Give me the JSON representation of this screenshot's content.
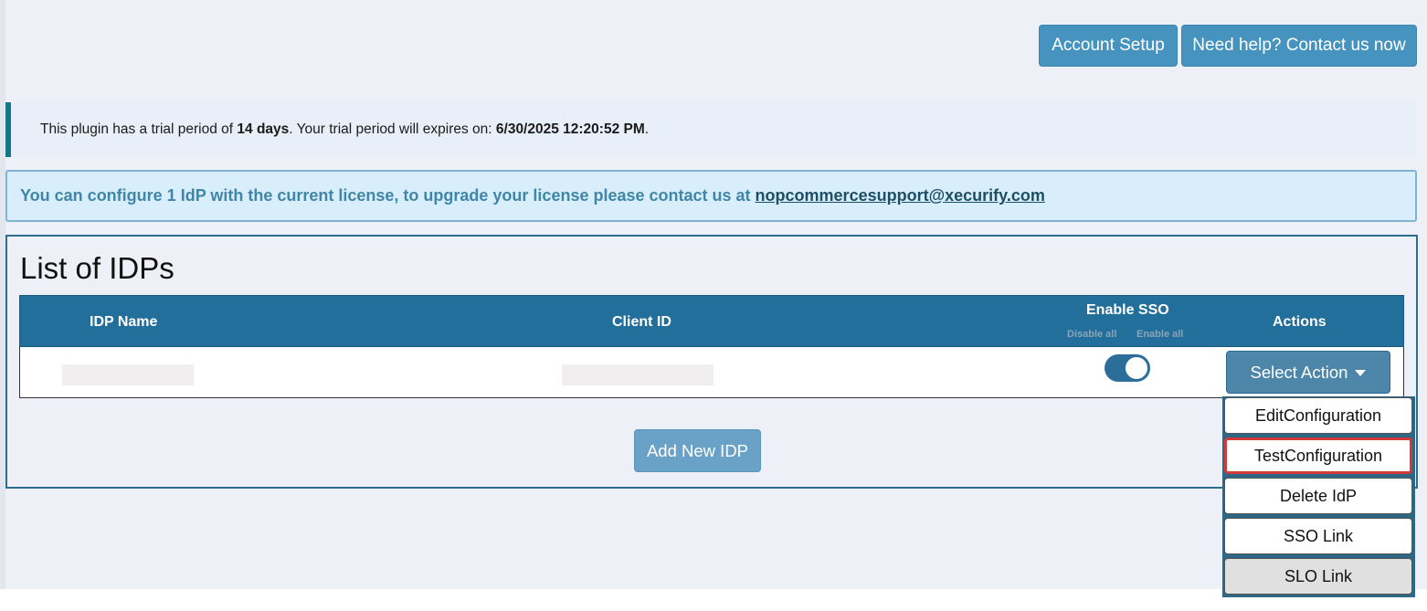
{
  "header": {
    "account_setup_label": "Account Setup",
    "help_label": "Need help? Contact us now"
  },
  "trial": {
    "prefix": "This plugin has a trial period of ",
    "days": "14 days",
    "middle": ". Your trial period will expires on: ",
    "expiry": "6/30/2025 12:20:52 PM",
    "suffix": "."
  },
  "license": {
    "text": "You can configure 1 IdP with the current license, to upgrade your license please contact us at",
    "email": "nopcommercesupport@xecurify.com"
  },
  "idp_list": {
    "title": "List of IDPs",
    "columns": {
      "name": "IDP Name",
      "client_id": "Client ID",
      "enable_sso": "Enable SSO",
      "actions": "Actions"
    },
    "disable_all": "Disable all",
    "enable_all": "Enable all",
    "rows": [
      {
        "sso_enabled": true,
        "action_label": "Select Action"
      }
    ],
    "add_button": "Add New IDP"
  },
  "action_menu": {
    "items": [
      "EditConfiguration",
      "TestConfiguration",
      "Delete IdP",
      "SSO Link",
      "SLO Link"
    ],
    "selected_index": 1,
    "hover_index": 4
  },
  "colors": {
    "primary": "#4593be",
    "table_header": "#236f9b",
    "trial_border": "#17758a",
    "license_bg": "#d8eefb",
    "selected_outline": "#d23a3a"
  }
}
